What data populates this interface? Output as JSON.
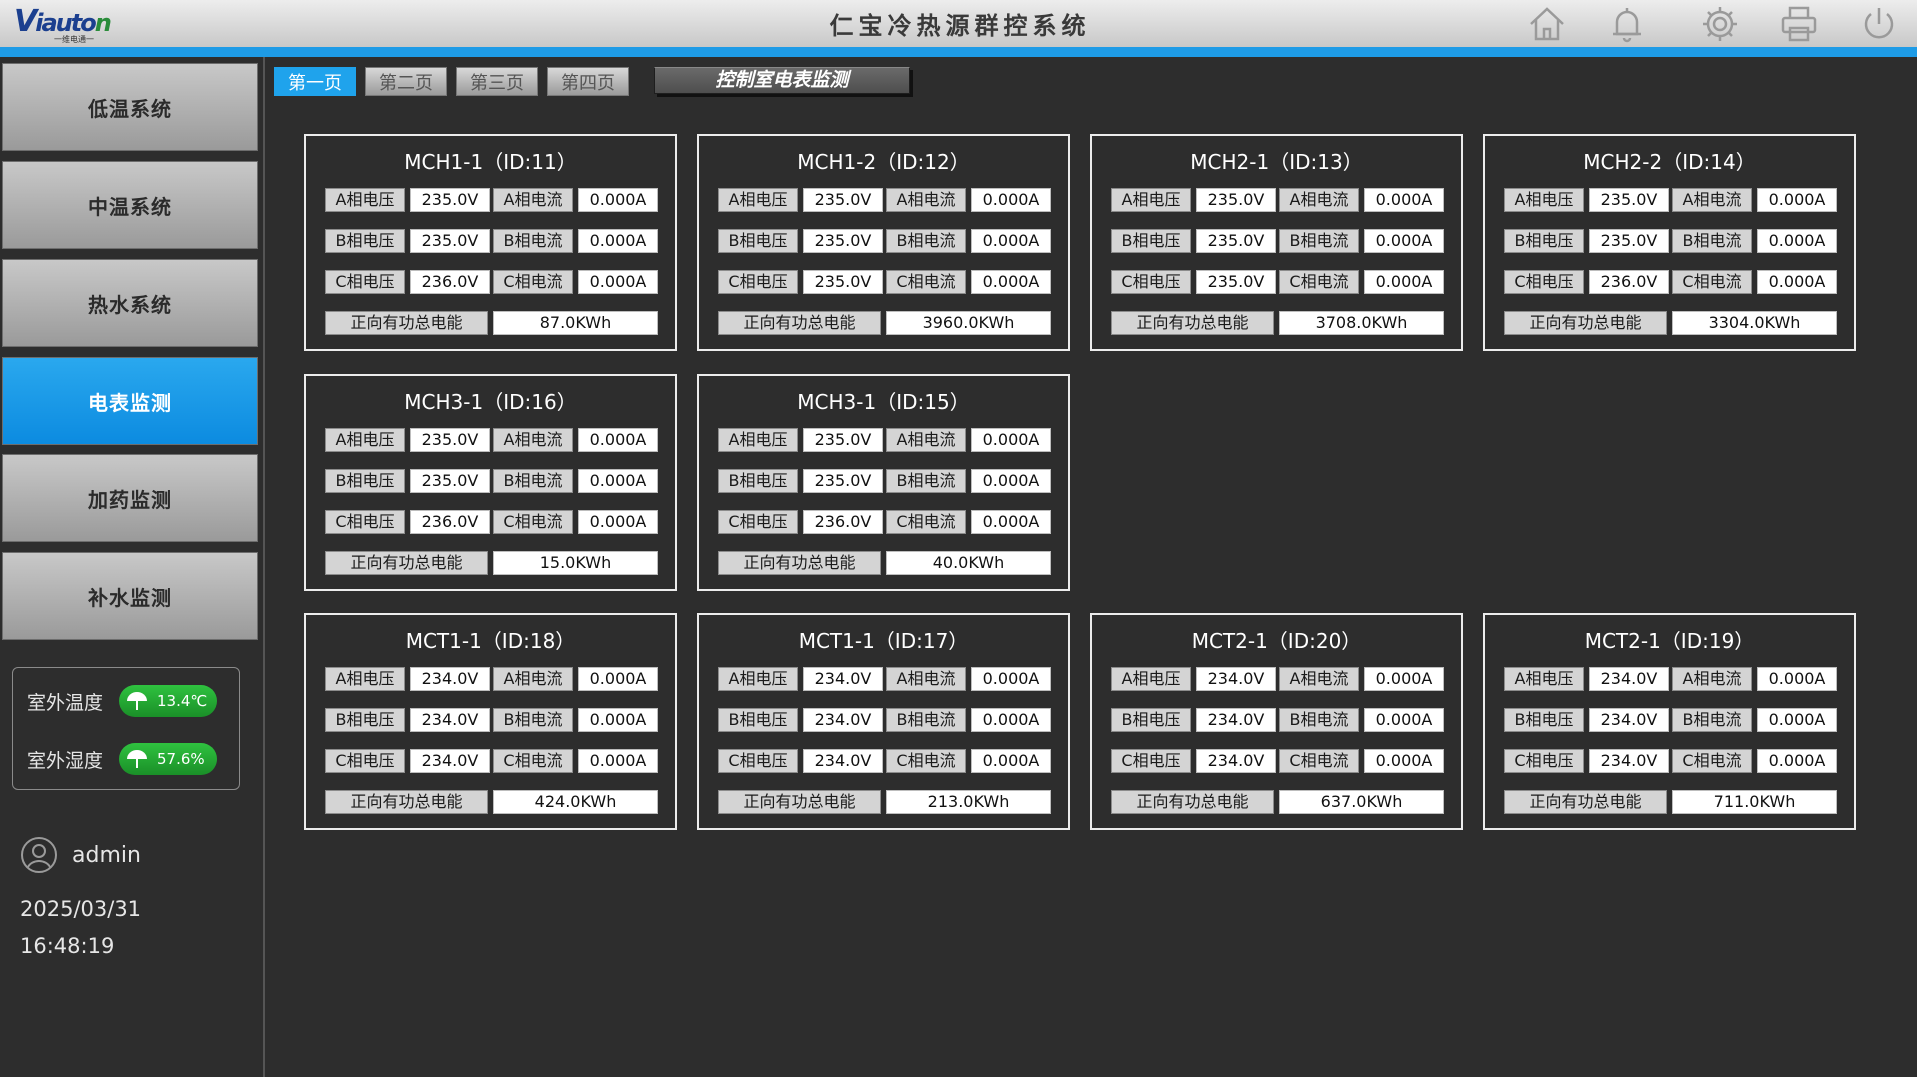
{
  "app": {
    "logo_text": "Viauton",
    "logo_subtext": "一维电通一",
    "title": "仁宝冷热源群控系统"
  },
  "header_icons": [
    "home-icon",
    "bell-icon",
    "gear-icon",
    "printer-icon",
    "power-icon"
  ],
  "colors": {
    "accent": "#1e9be6",
    "active_button": "#1fa3ec",
    "weather_pill": "#1fa62e",
    "panel_border": "#ececec"
  },
  "sidebar": {
    "items": [
      {
        "label": "低温系统",
        "active": false
      },
      {
        "label": "中温系统",
        "active": false
      },
      {
        "label": "热水系统",
        "active": false
      },
      {
        "label": "电表监测",
        "active": true
      },
      {
        "label": "加药监测",
        "active": false
      },
      {
        "label": "补水监测",
        "active": false
      }
    ],
    "weather": {
      "temp_label": "室外温度",
      "temp_value": "13.4℃",
      "humidity_label": "室外湿度",
      "humidity_value": "57.6%"
    },
    "user": "admin",
    "date": "2025/03/31",
    "time": "16:48:19"
  },
  "tabs": [
    {
      "label": "第一页",
      "active": true
    },
    {
      "label": "第二页",
      "active": false
    },
    {
      "label": "第三页",
      "active": false
    },
    {
      "label": "第四页",
      "active": false
    }
  ],
  "page_title": "控制室电表监测",
  "labels": {
    "a_voltage": "A相电压",
    "a_current": "A相电流",
    "b_voltage": "B相电压",
    "b_current": "B相电流",
    "c_voltage": "C相电压",
    "c_current": "C相电流",
    "energy": "正向有功总电能"
  },
  "meters": [
    {
      "name": "MCH1-1（ID:11）",
      "a_v": "235.0V",
      "a_i": "0.000A",
      "b_v": "235.0V",
      "b_i": "0.000A",
      "c_v": "236.0V",
      "c_i": "0.000A",
      "energy": "87.0KWh"
    },
    {
      "name": "MCH1-2（ID:12）",
      "a_v": "235.0V",
      "a_i": "0.000A",
      "b_v": "235.0V",
      "b_i": "0.000A",
      "c_v": "235.0V",
      "c_i": "0.000A",
      "energy": "3960.0KWh"
    },
    {
      "name": "MCH2-1（ID:13）",
      "a_v": "235.0V",
      "a_i": "0.000A",
      "b_v": "235.0V",
      "b_i": "0.000A",
      "c_v": "235.0V",
      "c_i": "0.000A",
      "energy": "3708.0KWh"
    },
    {
      "name": "MCH2-2（ID:14）",
      "a_v": "235.0V",
      "a_i": "0.000A",
      "b_v": "235.0V",
      "b_i": "0.000A",
      "c_v": "236.0V",
      "c_i": "0.000A",
      "energy": "3304.0KWh"
    },
    {
      "name": "MCH3-1（ID:16）",
      "a_v": "235.0V",
      "a_i": "0.000A",
      "b_v": "235.0V",
      "b_i": "0.000A",
      "c_v": "236.0V",
      "c_i": "0.000A",
      "energy": "15.0KWh"
    },
    {
      "name": "MCH3-1（ID:15）",
      "a_v": "235.0V",
      "a_i": "0.000A",
      "b_v": "235.0V",
      "b_i": "0.000A",
      "c_v": "236.0V",
      "c_i": "0.000A",
      "energy": "40.0KWh"
    },
    {
      "name": "MCT1-1（ID:18）",
      "a_v": "234.0V",
      "a_i": "0.000A",
      "b_v": "234.0V",
      "b_i": "0.000A",
      "c_v": "234.0V",
      "c_i": "0.000A",
      "energy": "424.0KWh"
    },
    {
      "name": "MCT1-1（ID:17）",
      "a_v": "234.0V",
      "a_i": "0.000A",
      "b_v": "234.0V",
      "b_i": "0.000A",
      "c_v": "234.0V",
      "c_i": "0.000A",
      "energy": "213.0KWh"
    },
    {
      "name": "MCT2-1（ID:20）",
      "a_v": "234.0V",
      "a_i": "0.000A",
      "b_v": "234.0V",
      "b_i": "0.000A",
      "c_v": "234.0V",
      "c_i": "0.000A",
      "energy": "637.0KWh"
    },
    {
      "name": "MCT2-1（ID:19）",
      "a_v": "234.0V",
      "a_i": "0.000A",
      "b_v": "234.0V",
      "b_i": "0.000A",
      "c_v": "234.0V",
      "c_i": "0.000A",
      "energy": "711.0KWh"
    }
  ]
}
